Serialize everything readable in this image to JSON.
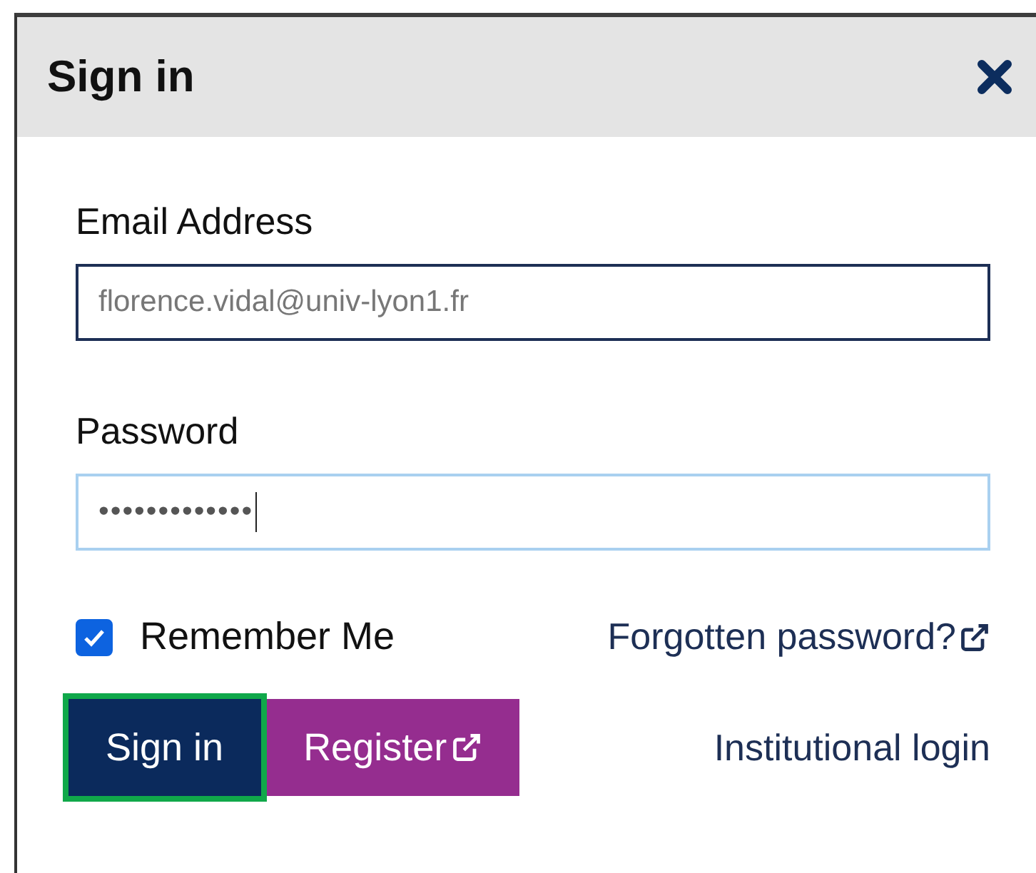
{
  "dialog": {
    "title": "Sign in"
  },
  "fields": [
    {
      "label": "Email Address",
      "value": "florence.vidal@univ-lyon1.fr",
      "focused": false
    },
    {
      "label": "Password",
      "value": "•••••••••••••",
      "focused": true
    }
  ],
  "remember": {
    "label": "Remember Me",
    "checked": true
  },
  "forgot_link": "Forgotten password?",
  "buttons": [
    {
      "label": "Sign in",
      "kind": "primary",
      "focused": true,
      "external": false
    },
    {
      "label": "Register",
      "kind": "secondary",
      "focused": false,
      "external": true
    }
  ],
  "institutional_link": "Institutional login"
}
